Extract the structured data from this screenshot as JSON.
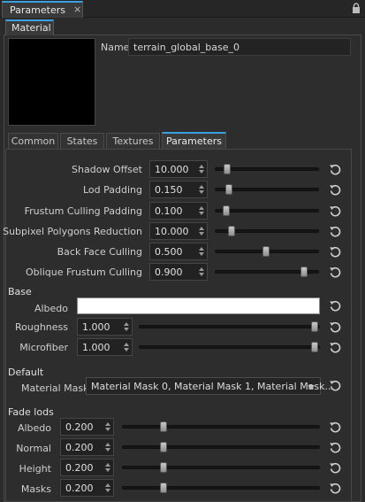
{
  "panel": {
    "title": "Parameters",
    "close": "×"
  },
  "material_tab": "Material",
  "name": {
    "label": "Name",
    "value": "terrain_global_base_0"
  },
  "subtabs": [
    "Common",
    "States",
    "Textures",
    "Parameters"
  ],
  "active_subtab": "Parameters",
  "params": [
    {
      "label": "Shadow Offset",
      "value": "10.000",
      "level": 0.09
    },
    {
      "label": "Lod Padding",
      "value": "0.150",
      "level": 0.11
    },
    {
      "label": "Frustum Culling Padding",
      "value": "0.100",
      "level": 0.08
    },
    {
      "label": "Subpixel Polygons Reduction",
      "value": "10.000",
      "level": 0.14
    },
    {
      "label": "Back Face Culling",
      "value": "0.500",
      "level": 0.5
    },
    {
      "label": "Oblique Frustum Culling",
      "value": "0.900",
      "level": 0.9
    }
  ],
  "base": {
    "title": "Base",
    "albedo_label": "Albedo",
    "albedo_color": "#ffffff",
    "rows": [
      {
        "label": "Roughness",
        "value": "1.000",
        "level": 1.0
      },
      {
        "label": "Microfiber",
        "value": "1.000",
        "level": 1.0
      }
    ]
  },
  "default": {
    "title": "Default",
    "mask_label": "Material Mask",
    "mask_value": "Material Mask 0, Material Mask 1, Material Mask..."
  },
  "fade": {
    "title": "Fade lods",
    "rows": [
      {
        "label": "Albedo",
        "value": "0.200",
        "level": 0.2
      },
      {
        "label": "Normal",
        "value": "0.200",
        "level": 0.2
      },
      {
        "label": "Height",
        "value": "0.200",
        "level": 0.2
      },
      {
        "label": "Masks",
        "value": "0.200",
        "level": 0.2
      }
    ]
  },
  "colors": {
    "accent": "#3aa0e0",
    "background": "#2b2b2b"
  },
  "icons": {
    "reset": "reset-icon",
    "lock": "lock-icon"
  }
}
